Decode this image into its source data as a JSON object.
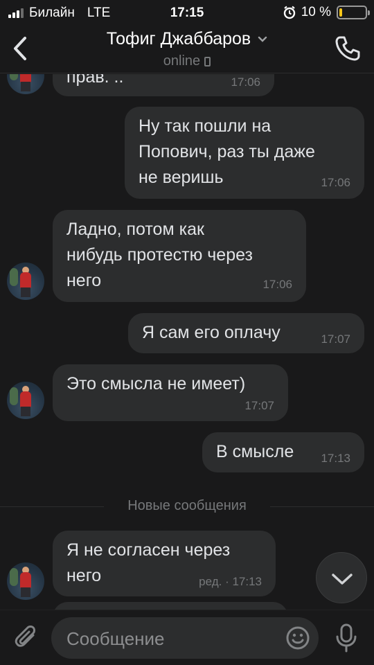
{
  "status_bar": {
    "carrier": "Билайн",
    "network": "LTE",
    "time": "17:15",
    "battery_text": "10 %",
    "battery_level": 0.1,
    "battery_color": "#f5c518"
  },
  "header": {
    "contact_name": "Тофиг Джаббаров",
    "status": "online",
    "back_icon": "chevron-left-icon",
    "call_icon": "phone-icon",
    "device_icon": "mobile-device-icon"
  },
  "messages": [
    {
      "direction": "in",
      "text": "прав. ..",
      "time": "17:06",
      "show_avatar": true
    },
    {
      "direction": "out",
      "text": "Ну так пошли на\nПопович, раз ты даже\nне веришь",
      "time": "17:06"
    },
    {
      "direction": "in",
      "text": "Ладно,  потом как\nнибудь протестю через\nнего",
      "time": "17:06",
      "show_avatar": true
    },
    {
      "direction": "out",
      "text": "Я сам его оплачу",
      "time": "17:07"
    },
    {
      "direction": "in",
      "text": "Это смысла не имеет)",
      "time": "17:07",
      "show_avatar": true
    },
    {
      "direction": "out",
      "text": "В смысле",
      "time": "17:13"
    },
    {
      "direction": "in",
      "text": "Я не согласен через\nнего",
      "time": "ред. · 17:13",
      "show_avatar": true
    }
  ],
  "new_messages_label": "Новые сообщения",
  "composer": {
    "placeholder": "Сообщение",
    "attach_icon": "paperclip-icon",
    "emoji_icon": "smile-icon",
    "mic_icon": "microphone-icon"
  },
  "colors": {
    "background": "#19191a",
    "bubble": "#2c2d2e",
    "secondary_text": "#76787a"
  }
}
